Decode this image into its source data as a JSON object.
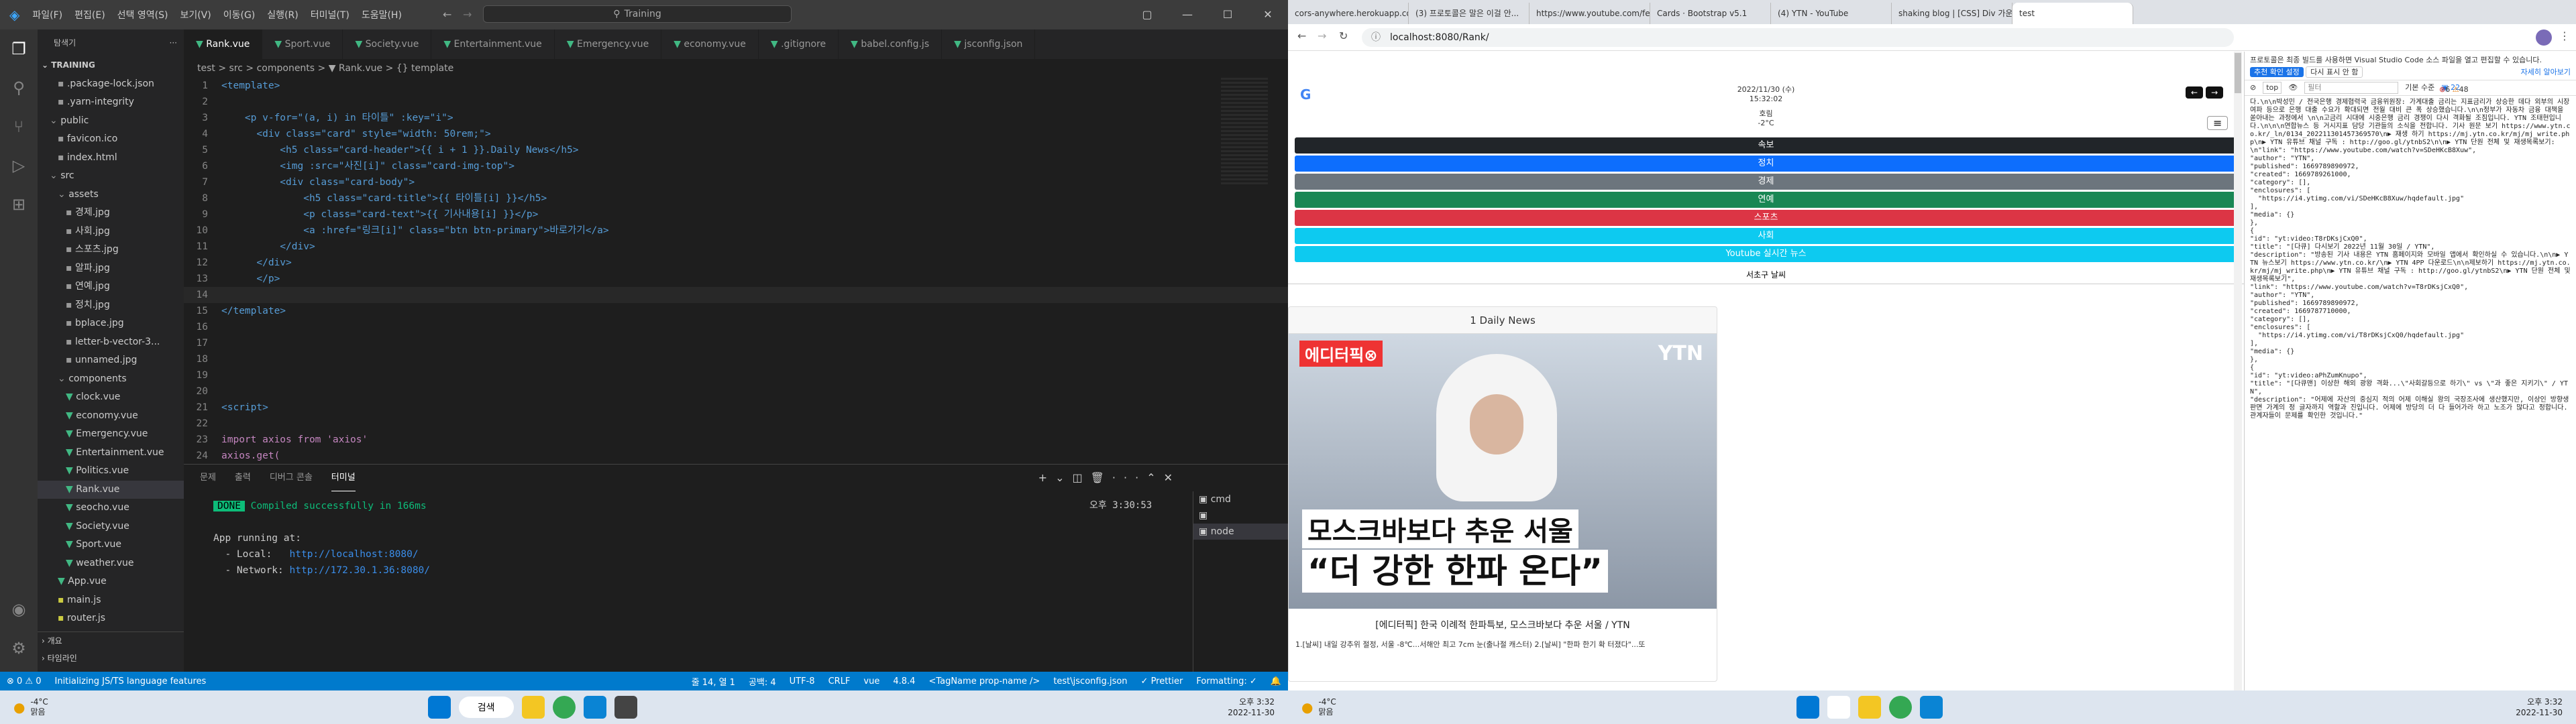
{
  "vscode": {
    "menu": [
      "파일(F)",
      "편집(E)",
      "선택 영역(S)",
      "보기(V)",
      "이동(G)",
      "실행(R)",
      "터미널(T)",
      "도움말(H)"
    ],
    "search": "Training",
    "explorer": {
      "title": "탐색기",
      "root": "TRAINING",
      "items": [
        ".package-lock.json",
        ".yarn-integrity",
        "public",
        "favicon.ico",
        "index.html",
        "src",
        "assets",
        "경제.jpg",
        "사회.jpg",
        "스포츠.jpg",
        "알파.jpg",
        "연예.jpg",
        "정치.jpg",
        "bplace.jpg",
        "letter-b-vector-3...",
        "unnamed.jpg",
        "components",
        "clock.vue",
        "economy.vue",
        "Emergency.vue",
        "Entertainment.vue",
        "Politics.vue",
        "Rank.vue",
        "seocho.vue",
        "Society.vue",
        "Sport.vue",
        "weather.vue",
        "App.vue",
        "main.js",
        "router.js"
      ],
      "outline": "개요",
      "timeline": "타임라인"
    },
    "tabs": [
      "Rank.vue",
      "Sport.vue",
      "Society.vue",
      "Entertainment.vue",
      "Emergency.vue",
      "economy.vue",
      ".gitignore",
      "babel.config.js",
      "jsconfig.json"
    ],
    "breadcrumb": "test > src > components > ▼ Rank.vue > {} template",
    "code": [
      {
        "n": "1",
        "t": "<template>"
      },
      {
        "n": "2",
        "t": ""
      },
      {
        "n": "3",
        "t": "    <p v-for=\"(a, i) in 타이틀\" :key=\"i\">"
      },
      {
        "n": "4",
        "t": "      <div class=\"card\" style=\"width: 50rem;\">"
      },
      {
        "n": "5",
        "t": "          <h5 class=\"card-header\">{{ i + 1 }}.Daily News</h5>"
      },
      {
        "n": "6",
        "t": "          <img :src=\"사진[i]\" class=\"card-img-top\">"
      },
      {
        "n": "7",
        "t": "          <div class=\"card-body\">"
      },
      {
        "n": "8",
        "t": "              <h5 class=\"card-title\">{{ 타이틀[i] }}</h5>"
      },
      {
        "n": "9",
        "t": "              <p class=\"card-text\">{{ 기사내용[i] }}</p>"
      },
      {
        "n": "10",
        "t": "              <a :href=\"링크[i]\" class=\"btn btn-primary\">바로가기</a>"
      },
      {
        "n": "11",
        "t": "          </div>"
      },
      {
        "n": "12",
        "t": "      </div>"
      },
      {
        "n": "13",
        "t": "      </p>"
      },
      {
        "n": "14",
        "t": ""
      },
      {
        "n": "15",
        "t": "</template>"
      },
      {
        "n": "16",
        "t": ""
      },
      {
        "n": "17",
        "t": ""
      },
      {
        "n": "18",
        "t": ""
      },
      {
        "n": "19",
        "t": ""
      },
      {
        "n": "20",
        "t": ""
      },
      {
        "n": "21",
        "t": "<script>"
      },
      {
        "n": "22",
        "t": ""
      },
      {
        "n": "23",
        "t": "import axios from 'axios'"
      },
      {
        "n": "24",
        "t": "axios.get("
      }
    ],
    "panel": {
      "tabs": [
        "문제",
        "출력",
        "디버그 콘솔",
        "터미널"
      ],
      "done": "DONE",
      "compiled": "Compiled successfully in 166ms",
      "time": "오후 3:30:53",
      "running": "App running at:",
      "local_label": "  - Local:   ",
      "local": "http://localhost:8080/",
      "net_label": "  - Network: ",
      "net": "http://172.30.1.36:8080/",
      "terms": [
        "cmd",
        "",
        "node"
      ]
    },
    "status": {
      "errors": "⊗ 0  ⚠ 0",
      "init": "Initializing JS/TS language features",
      "pos": "줄 14, 열 1",
      "spaces": "공백: 4",
      "enc": "UTF-8",
      "eol": "CRLF",
      "lang": "vue",
      "ver": "4.8.4",
      "tag": "<TagName prop-name />",
      "cfg": "test\\jsconfig.json",
      "prettier": "✓ Prettier",
      "fmt": "Formatting: ✓"
    }
  },
  "taskbar": {
    "temp": "-4°C",
    "cond": "맑음",
    "search": "검색",
    "time": "오후 3:32",
    "date": "2022-11-30"
  },
  "chrome": {
    "tabs": [
      "cors-anywhere.herokuapp.com",
      "(3) 프로토콜은 말은 이걸 안...",
      "https://www.youtube.com/feeds/",
      "Cards · Bootstrap v5.1",
      "(4) YTN - YouTube",
      "shaking blog | [CSS] Div 가운...",
      "test"
    ],
    "url": "localhost:8080/Rank/",
    "date": "2022/11/30 (수)",
    "clock": "15:32:02",
    "loc": "호림",
    "temp": "-2°C",
    "nav": [
      {
        "label": "속보",
        "color": "#212529"
      },
      {
        "label": "정치",
        "color": "#0d6efd"
      },
      {
        "label": "경제",
        "color": "#6c757d"
      },
      {
        "label": "연예",
        "color": "#198754"
      },
      {
        "label": "스포츠",
        "color": "#dc3545"
      },
      {
        "label": "사회",
        "color": "#0dcaf0"
      },
      {
        "label": "Youtube 실시간 뉴스",
        "color": "#0dcaf0"
      }
    ],
    "seocho": "서초구 날씨",
    "card_header": "1 Daily News",
    "thumb": {
      "brand": "에디터픽⊗",
      "channel": "YTN",
      "line1": "모스크바보다 추운 서울",
      "line2": "“더 강한 한파 온다”"
    },
    "card_title": "[에디터픽] 한국 이례적 한파특보, 모스크바보다 추운 서울 / YTN",
    "card_text": "1.[날씨] 내일 강추위 절정, 서울 -8℃...서해안 최고 7cm 눈(출나절 캐스터) 2.[날씨] \"한파 한기 확 터졌다\"...또",
    "devtools": {
      "notice": "프로토콜은 최종 빌드를 사용하면 Visual Studio Code 소스 파일을 열고 편집할 수 있습니다.",
      "btn1": "추천 확인 설정",
      "btn2": "다시 표시 안 함",
      "link": "자세히 알아보기",
      "top": "top",
      "filter": "필터",
      "levels": "기본 수준",
      "errors": "6",
      "warnings": "48",
      "issues": "22",
      "log": "다.\\n\\n박성민 / 전국은행 경제협력국 금융위원장: 가계대출 금리는 지표금리가 상승한 데다 외부의 시장 여파 등으로 은행 대출 수요가 확대되면 전월 대비 큰 폭 상승했습니다.\\n\\n정부가 자동차 금융 대책을 쏟아내는 과정에서 \\n\\n고금리 시대에 시중은행 금리 경쟁이 다시 격화될 조짐입니다. YTN 조태현입니다.\\n\\n\\n연합뉴스 등 거시지표 담당 기관들의 소식을 전합니다. 기사 원문 보기 https://www.ytn.co.kr/_ln/0134_202211301457369570\\n▶ 재생 하기 https://mj.ytn.co.kr/mj/mj_write.php\\n▶ YTN 유튜브 채널 구독 : http://goo.gl/ytnbS2\\n\\n▶ YTN 단원 전체 및 재생목록보기: \\n\"link\": \"https://www.youtube.com/watch?v=SDeHKcB8Xuw\",\n\"author\": \"YTN\",\n\"published\": 1669789890972,\n\"created\": 1669789261000,\n\"category\": [],\n\"enclosures\": [\n  \"https://i4.ytimg.com/vi/SDeHKcB8Xuw/hqdefault.jpg\"\n],\n\"media\": {}\n},\n{\n\"id\": \"yt:video:T8rDKsjCxQ0\",\n\"title\": \"[다큐] 다시보기 2022년 11월 30일 / YTN\",\n\"description\": \"방송된 기사 내용은 YTN 홈페이지와 모바일 앱에서 확인하실 수 있습니다.\\n\\n▶ YTN 뉴스보기 https://www.ytn.co.kr/\\n▶ YTN 4PP 다운로드\\n\\n제보하기 https://mj.ytn.co.kr/mj/mj_write.php\\n▶ YTN 유튜브 채널 구독 : http://goo.gl/ytnbS2\\n▶ YTN 단원 전체 및 재생목록보기\",\n\"link\": \"https://www.youtube.com/watch?v=T8rDKsjCxQ0\",\n\"author\": \"YTN\",\n\"published\": 1669789890972,\n\"created\": 1669787710000,\n\"category\": [],\n\"enclosures\": [\n  \"https://i4.ytimg.com/vi/T8rDKsjCxQ0/hqdefault.jpg\"\n],\n\"media\": {}\n},\n{\n\"id\": \"yt:video:aPhZumKnupo\",\n\"title\": \"[다큐맨] 이상한 해외 광왕 격화...\\\"사회갈등으로 하기\\\" vs \\\"과 좋은 지키기\\\" / YTN\",\n\"description\": \"어제에 자산의 중심지 적의 어제 이해실 왕의 국장조사에 생산했지만, 이상인 방향생 판면 가계의 정 글자까지 역할과 진입니다. 어제에 방당의 더 다 들어가라 하고 노조가 많다고 정합니다. 관계자들이 문제를 확인한 것입니다.\"\n"
    }
  }
}
